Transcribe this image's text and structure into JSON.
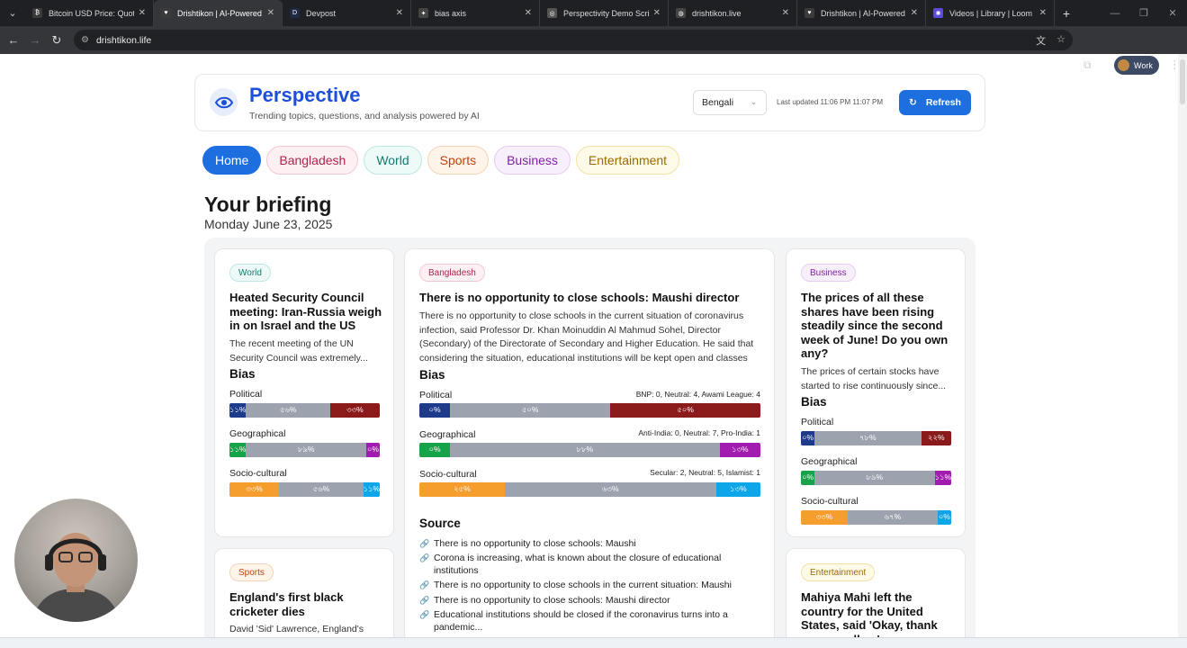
{
  "browser": {
    "tabs": [
      {
        "title": "Bitcoin USD Price: Quote",
        "fav": "₿",
        "favcolor": "#3b3b3b"
      },
      {
        "title": "Drishtikon | AI-Powered D",
        "fav": "♥",
        "favcolor": "#3b3b3b",
        "active": true
      },
      {
        "title": "Devpost",
        "fav": "D",
        "favcolor": "#1f2a44"
      },
      {
        "title": "bias axis",
        "fav": "✦",
        "favcolor": "#444"
      },
      {
        "title": "Perspectivity Demo Script",
        "fav": "◎",
        "favcolor": "#555"
      },
      {
        "title": "drishtikon.live",
        "fav": "◍",
        "favcolor": "#444"
      },
      {
        "title": "Drishtikon | AI-Powered D",
        "fav": "♥",
        "favcolor": "#3b3b3b"
      },
      {
        "title": "Videos | Library | Loom",
        "fav": "✺",
        "favcolor": "#5b4bd6"
      }
    ],
    "url": "drishtikon.life",
    "profile_label": "Work"
  },
  "header": {
    "brand": "Perspective",
    "tagline": "Trending topics, questions, and analysis powered by AI",
    "language": "Bengali",
    "last_updated": "Last updated 11:06 PM 11:07 PM",
    "refresh_label": "Refresh"
  },
  "nav": [
    {
      "label": "Home",
      "bg": "#1d6fe0",
      "fg": "#ffffff",
      "border": "#1d6fe0"
    },
    {
      "label": "Bangladesh",
      "bg": "#fdf0f3",
      "fg": "#b0244a",
      "border": "#f4c6d2"
    },
    {
      "label": "World",
      "bg": "#edfaf8",
      "fg": "#147a6e",
      "border": "#bce9e2"
    },
    {
      "label": "Sports",
      "bg": "#fff4ea",
      "fg": "#c2410c",
      "border": "#f7d4b4"
    },
    {
      "label": "Business",
      "bg": "#f7effa",
      "fg": "#7e22a5",
      "border": "#e6cdf0"
    },
    {
      "label": "Entertainment",
      "bg": "#fefae8",
      "fg": "#9a6b00",
      "border": "#f1e3a4"
    }
  ],
  "briefing": {
    "title": "Your briefing",
    "date": "Monday June 23, 2025"
  },
  "colors": {
    "political_left": "#1e3a8a",
    "neutral": "#9ca3af",
    "political_right": "#8b1a1a",
    "geo_left": "#16a34a",
    "geo_right": "#a21caf",
    "socio_left": "#f59e2d",
    "socio_right": "#0ea5e9"
  },
  "labels": {
    "bias": "Bias",
    "political": "Political",
    "geographical": "Geographical",
    "socio_cultural": "Socio-cultural",
    "source": "Source"
  },
  "cards": {
    "world": {
      "badge": "World",
      "title": "Heated Security Council meeting: Iran-Russia weigh in on Israel and the US",
      "summary": "The recent meeting of the UN Security Council was extremely...",
      "political": {
        "labels": [
          "১১%",
          "৫৬%",
          "৩৩%"
        ],
        "values": [
          11,
          56,
          33
        ]
      },
      "geographical": {
        "labels": [
          "১১%",
          "৮৯%",
          "০%"
        ],
        "values": [
          11,
          80,
          9
        ]
      },
      "socio": {
        "labels": [
          "৩৩%",
          "৫৬%",
          "১১%"
        ],
        "values": [
          33,
          56,
          11
        ]
      }
    },
    "bangladesh": {
      "badge": "Bangladesh",
      "title": "There is no opportunity to close schools: Maushi director",
      "summary": "There is no opportunity to close schools in the current situation of coronavirus infection, said Professor Dr. Khan Moinuddin Al Mahmud Sohel, Director (Secondary) of the Directorate of Secondary and Higher Education. He said that considering the situation, educational institutions will be kept open and classes w...",
      "political": {
        "counts": "BNP: 0, Neutral: 4, Awami League: 4",
        "labels": [
          "০%",
          "৫০%",
          "৫০%"
        ],
        "values": [
          9,
          47,
          44
        ]
      },
      "geographical": {
        "counts": "Anti-India: 0, Neutral: 7, Pro-India: 1",
        "labels": [
          "০%",
          "৮৮%",
          "১৩%"
        ],
        "values": [
          9,
          79,
          12
        ]
      },
      "socio": {
        "counts": "Secular: 2, Neutral: 5, Islamist: 1",
        "labels": [
          "২৫%",
          "৬৩%",
          "১৩%"
        ],
        "values": [
          25,
          62,
          13
        ]
      },
      "sources": [
        "There is no opportunity to close schools: Maushi",
        "Corona is increasing, what is known about the closure of educational institutions",
        "There is no opportunity to close schools in the current situation: Maushi",
        "There is no opportunity to close schools: Maushi director",
        "Educational institutions should be closed if the coronavirus turns into a pandemic..."
      ]
    },
    "business": {
      "badge": "Business",
      "title": "The prices of all these shares have been rising steadily since the second week of June! Do you own any?",
      "summary": "The prices of certain stocks have started to rise continuously since...",
      "political": {
        "labels": [
          "০%",
          "৭৮%",
          "২২%"
        ],
        "values": [
          9,
          71,
          20
        ]
      },
      "geographical": {
        "labels": [
          "০%",
          "৮৯%",
          "১১%"
        ],
        "values": [
          9,
          80,
          11
        ]
      },
      "socio": {
        "labels": [
          "৩৩%",
          "৬৭%",
          "০%"
        ],
        "values": [
          31,
          60,
          9
        ]
      }
    },
    "sports": {
      "badge": "Sports",
      "title": "England's first black cricketer dies",
      "summary": "David 'Sid' Lawrence, England's"
    },
    "entertainment": {
      "badge": "Entertainment",
      "title": "Mahiya Mahi left the country for the United States, said 'Okay, thank you, goodbye'"
    }
  }
}
